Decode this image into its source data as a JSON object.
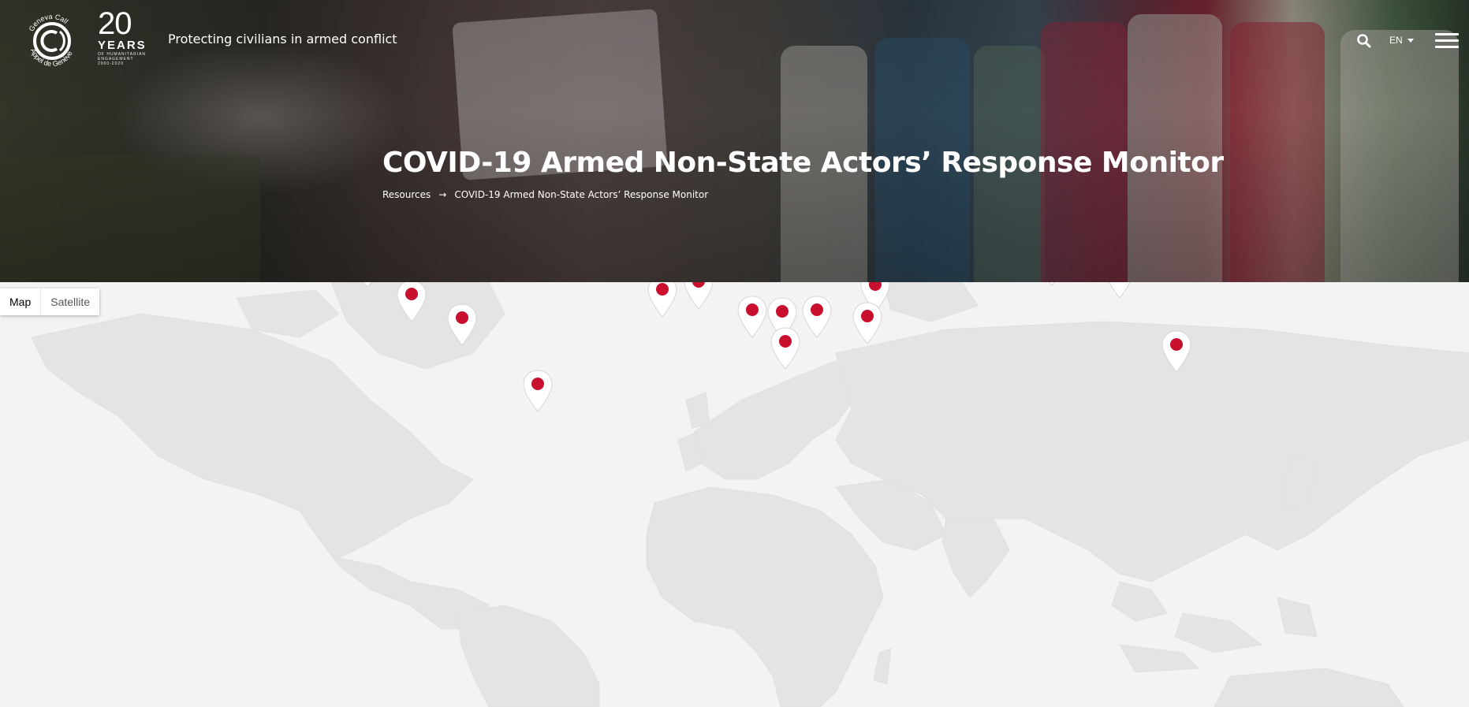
{
  "header": {
    "logo_text_top": "Geneva Call",
    "logo_text_bottom": "Appel de Genève",
    "anniversary_number": "20",
    "anniversary_word": "YEARS",
    "anniversary_small_1": "OF HUMANITARIAN",
    "anniversary_small_2": "ENGAGEMENT",
    "anniversary_small_3": "2000-2020",
    "tagline": "Protecting civilians in armed conflict",
    "language": "EN",
    "search_icon": "search-icon",
    "menu_icon": "hamburger-menu-icon"
  },
  "hero": {
    "title": "COVID-19 Armed Non-State Actors’ Response Monitor",
    "breadcrumb": {
      "root": "Resources",
      "separator": "→",
      "current": "COVID-19 Armed Non-State Actors’ Response Monitor"
    }
  },
  "map": {
    "type_controls": [
      "Map",
      "Satellite"
    ],
    "selected_type": "Map",
    "marker_color": "#c8102e",
    "marker_count": 28
  }
}
